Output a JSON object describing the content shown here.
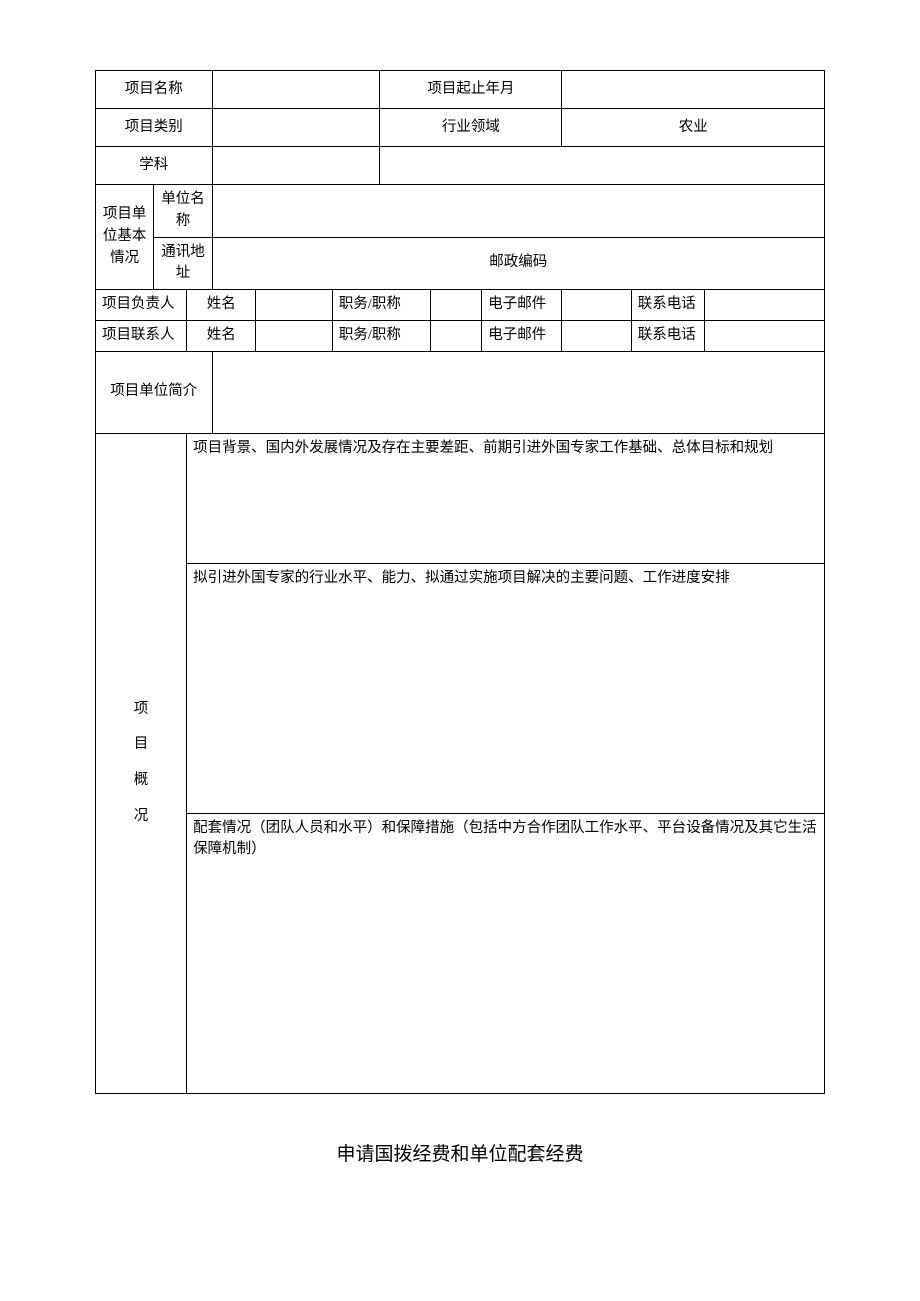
{
  "labels": {
    "project_name": "项目名称",
    "project_period": "项目起止年月",
    "project_category": "项目类别",
    "industry_field": "行业领域",
    "discipline": "学科",
    "unit_basic": "项目单位基本情况",
    "unit_name": "单位名称",
    "address": "通讯地址",
    "postal_code": "邮政编码",
    "leader": "项目负责人",
    "contact": "项目联系人",
    "name": "姓名",
    "position": "职务/职称",
    "email": "电子邮件",
    "phone": "联系电话",
    "unit_intro": "项目单位简介",
    "overview_c1": "项",
    "overview_c2": "目",
    "overview_c3": "概",
    "overview_c4": "况",
    "section1": "项目背景、国内外发展情况及存在主要差距、前期引进外国专家工作基础、总体目标和规划",
    "section2": "拟引进外国专家的行业水平、能力、拟通过实施项目解决的主要问题、工作进度安排",
    "section3": "配套情况（团队人员和水平）和保障措施（包括中方合作团队工作水平、平台设备情况及其它生活保障机制）"
  },
  "values": {
    "industry_field": "农业"
  },
  "footer": {
    "title": "申请国拨经费和单位配套经费"
  }
}
